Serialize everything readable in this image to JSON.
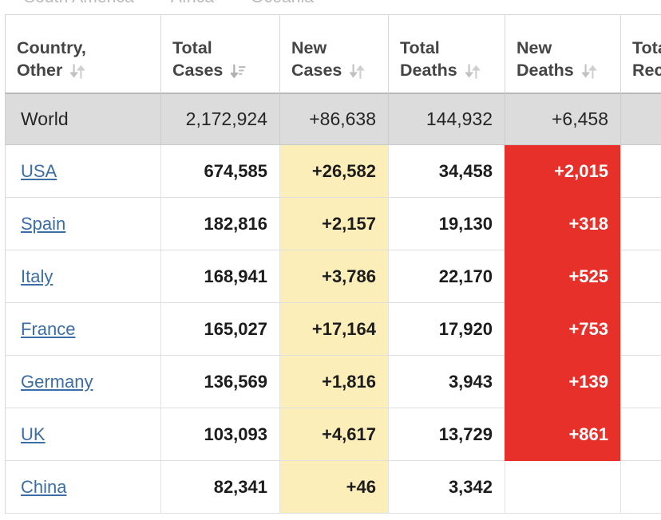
{
  "tabs": [
    {
      "label": "South America"
    },
    {
      "label": "Africa"
    },
    {
      "label": "Oceania"
    }
  ],
  "table": {
    "columns": [
      {
        "key": "country",
        "line1": "Country,",
        "line2": "Other",
        "sort_icon": "sort-both-icon",
        "sort_state": "none"
      },
      {
        "key": "tcases",
        "line1": "Total",
        "line2": "Cases",
        "sort_icon": "sort-descending-icon",
        "sort_state": "desc"
      },
      {
        "key": "ncases",
        "line1": "New",
        "line2": "Cases",
        "sort_icon": "sort-both-icon",
        "sort_state": "none"
      },
      {
        "key": "tdeaths",
        "line1": "Total",
        "line2": "Deaths",
        "sort_icon": "sort-both-icon",
        "sort_state": "none"
      },
      {
        "key": "ndeaths",
        "line1": "New",
        "line2": "Deaths",
        "sort_icon": "sort-both-icon",
        "sort_state": "none"
      },
      {
        "key": "trec",
        "line1": "Total",
        "line2": "Rec",
        "sort_icon": "none",
        "sort_state": "none"
      }
    ],
    "rows": [
      {
        "country": "World",
        "is_world": true,
        "is_link": false,
        "total_cases": "2,172,924",
        "new_cases": "+86,638",
        "total_deaths": "144,932",
        "new_deaths": "+6,458",
        "total_recovered": ""
      },
      {
        "country": "USA",
        "is_world": false,
        "is_link": true,
        "total_cases": "674,585",
        "new_cases": "+26,582",
        "total_deaths": "34,458",
        "new_deaths": "+2,015",
        "total_recovered": ""
      },
      {
        "country": "Spain",
        "is_world": false,
        "is_link": true,
        "total_cases": "182,816",
        "new_cases": "+2,157",
        "total_deaths": "19,130",
        "new_deaths": "+318",
        "total_recovered": ""
      },
      {
        "country": "Italy",
        "is_world": false,
        "is_link": true,
        "total_cases": "168,941",
        "new_cases": "+3,786",
        "total_deaths": "22,170",
        "new_deaths": "+525",
        "total_recovered": ""
      },
      {
        "country": "France",
        "is_world": false,
        "is_link": true,
        "total_cases": "165,027",
        "new_cases": "+17,164",
        "total_deaths": "17,920",
        "new_deaths": "+753",
        "total_recovered": ""
      },
      {
        "country": "Germany",
        "is_world": false,
        "is_link": true,
        "total_cases": "136,569",
        "new_cases": "+1,816",
        "total_deaths": "3,943",
        "new_deaths": "+139",
        "total_recovered": ""
      },
      {
        "country": "UK",
        "is_world": false,
        "is_link": true,
        "total_cases": "103,093",
        "new_cases": "+4,617",
        "total_deaths": "13,729",
        "new_deaths": "+861",
        "total_recovered": ""
      },
      {
        "country": "China",
        "is_world": false,
        "is_link": true,
        "total_cases": "82,341",
        "new_cases": "+46",
        "total_deaths": "3,342",
        "new_deaths": "",
        "total_recovered": ""
      }
    ]
  },
  "colors": {
    "new_cases_highlight": "#fbeeb9",
    "new_deaths_highlight": "#e8302a",
    "world_row_background": "#dcdcdc",
    "link": "#3a6ea5",
    "header_text": "#454545"
  }
}
